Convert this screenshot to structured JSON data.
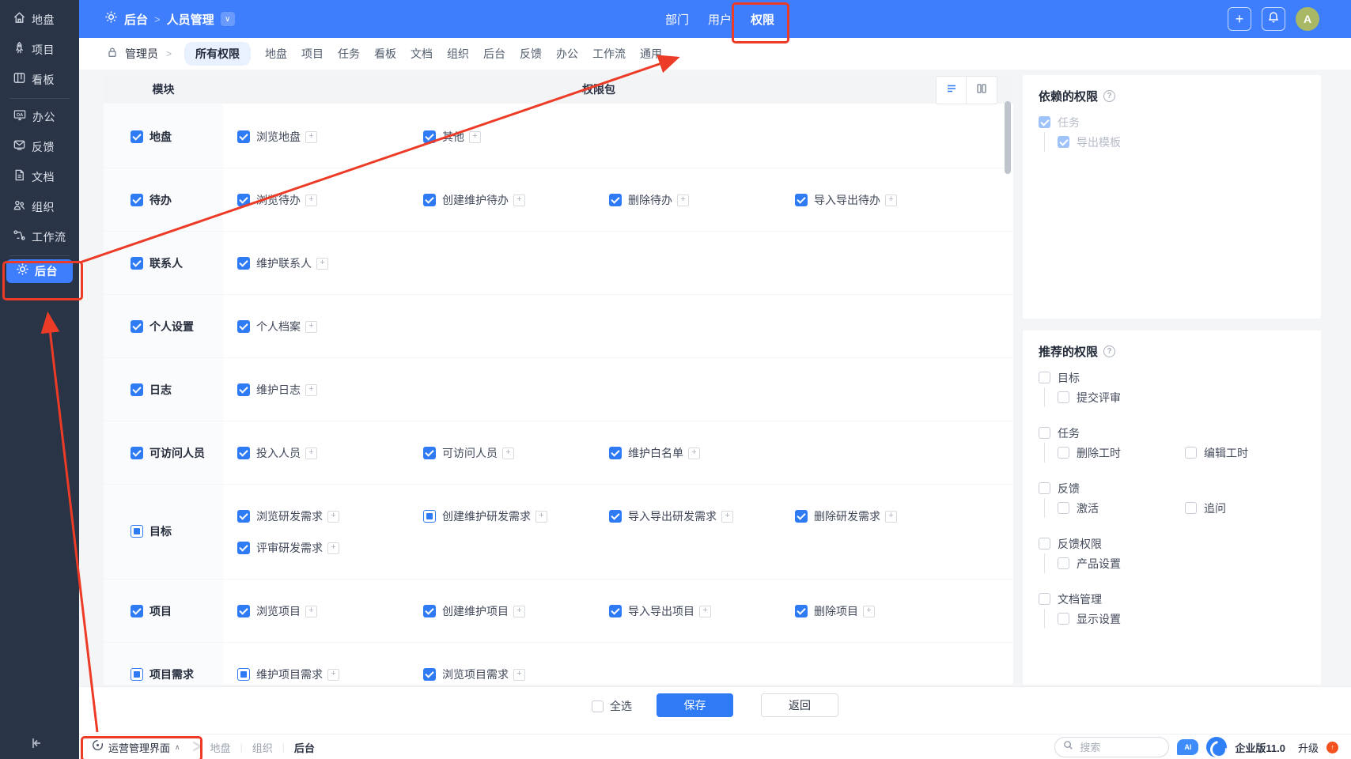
{
  "colors": {
    "accent": "#3e7dfc",
    "checkbox_blue": "#2f7bf6",
    "annotation_red": "#ec3b26",
    "sidebar_bg": "#2a3447",
    "avatar_bg": "#a8b864",
    "upgrade_badge": "#f4511e"
  },
  "glyphs": {
    "plus": "+",
    "chevron_down": "∨",
    "chevron_up": "∧",
    "gt": ">",
    "pipe": "|",
    "arrow_up": "↑"
  },
  "sidebar": {
    "items": [
      {
        "label": "地盘",
        "icon": "home-icon"
      },
      {
        "label": "项目",
        "icon": "rocket-icon"
      },
      {
        "label": "看板",
        "icon": "kanban-icon",
        "divider_after": true
      },
      {
        "label": "办公",
        "icon": "monitor-icon"
      },
      {
        "label": "反馈",
        "icon": "feedback-icon"
      },
      {
        "label": "文档",
        "icon": "document-icon"
      },
      {
        "label": "组织",
        "icon": "org-icon"
      },
      {
        "label": "工作流",
        "icon": "workflow-icon",
        "divider_after": true
      },
      {
        "label": "后台",
        "icon": "gear-icon",
        "active": true
      }
    ]
  },
  "header": {
    "breadcrumb": {
      "root": "后台",
      "current": "人员管理"
    },
    "tabs": [
      {
        "label": "部门"
      },
      {
        "label": "用户"
      },
      {
        "label": "权限",
        "highlighted": true
      }
    ],
    "avatar": "A"
  },
  "toolbar": {
    "role_label": "管理员",
    "tabs": [
      {
        "label": "所有权限",
        "active": true
      },
      {
        "label": "地盘"
      },
      {
        "label": "项目"
      },
      {
        "label": "任务"
      },
      {
        "label": "看板"
      },
      {
        "label": "文档"
      },
      {
        "label": "组织"
      },
      {
        "label": "后台"
      },
      {
        "label": "反馈"
      },
      {
        "label": "办公"
      },
      {
        "label": "工作流"
      },
      {
        "label": "通用"
      }
    ]
  },
  "table": {
    "module_header": "模块",
    "package_header": "权限包",
    "rows": [
      {
        "module": "地盘",
        "state": "checked",
        "perms": [
          {
            "label": "浏览地盘",
            "state": "checked",
            "col": 0,
            "line": 0
          },
          {
            "label": "其他",
            "state": "checked",
            "col": 1,
            "line": 0
          }
        ]
      },
      {
        "module": "待办",
        "state": "checked",
        "perms": [
          {
            "label": "浏览待办",
            "state": "checked",
            "col": 0,
            "line": 0
          },
          {
            "label": "创建维护待办",
            "state": "checked",
            "col": 1,
            "line": 0
          },
          {
            "label": "删除待办",
            "state": "checked",
            "col": 2,
            "line": 0
          },
          {
            "label": "导入导出待办",
            "state": "checked",
            "col": 3,
            "line": 0
          }
        ]
      },
      {
        "module": "联系人",
        "state": "checked",
        "perms": [
          {
            "label": "维护联系人",
            "state": "checked",
            "col": 0,
            "line": 0
          }
        ]
      },
      {
        "module": "个人设置",
        "state": "checked",
        "perms": [
          {
            "label": "个人档案",
            "state": "checked",
            "col": 0,
            "line": 0
          }
        ]
      },
      {
        "module": "日志",
        "state": "checked",
        "perms": [
          {
            "label": "维护日志",
            "state": "checked",
            "col": 0,
            "line": 0
          }
        ]
      },
      {
        "module": "可访问人员",
        "state": "checked",
        "perms": [
          {
            "label": "投入人员",
            "state": "checked",
            "col": 0,
            "line": 0
          },
          {
            "label": "可访问人员",
            "state": "checked",
            "col": 1,
            "line": 0
          },
          {
            "label": "维护白名单",
            "state": "checked",
            "col": 2,
            "line": 0
          }
        ]
      },
      {
        "module": "目标",
        "state": "indet",
        "tall": true,
        "perms": [
          {
            "label": "浏览研发需求",
            "state": "checked",
            "col": 0,
            "line": 0
          },
          {
            "label": "创建维护研发需求",
            "state": "indet",
            "col": 1,
            "line": 0
          },
          {
            "label": "导入导出研发需求",
            "state": "checked",
            "col": 2,
            "line": 0
          },
          {
            "label": "删除研发需求",
            "state": "checked",
            "col": 3,
            "line": 0
          },
          {
            "label": "评审研发需求",
            "state": "checked",
            "col": 0,
            "line": 1
          }
        ]
      },
      {
        "module": "项目",
        "state": "checked",
        "perms": [
          {
            "label": "浏览项目",
            "state": "checked",
            "col": 0,
            "line": 0
          },
          {
            "label": "创建维护项目",
            "state": "checked",
            "col": 1,
            "line": 0
          },
          {
            "label": "导入导出项目",
            "state": "checked",
            "col": 2,
            "line": 0
          },
          {
            "label": "删除项目",
            "state": "checked",
            "col": 3,
            "line": 0
          }
        ]
      },
      {
        "module": "项目需求",
        "state": "indet",
        "perms": [
          {
            "label": "维护项目需求",
            "state": "indet",
            "col": 0,
            "line": 0
          },
          {
            "label": "浏览项目需求",
            "state": "checked",
            "col": 1,
            "line": 0
          }
        ]
      }
    ]
  },
  "deps_panel": {
    "title": "依赖的权限",
    "groups": [
      {
        "label": "任务",
        "state": "disabled-checked",
        "children": [
          {
            "label": "导出模板",
            "state": "disabled-checked"
          }
        ]
      }
    ]
  },
  "rec_panel": {
    "title": "推荐的权限",
    "groups": [
      {
        "label": "目标",
        "state": "unchecked",
        "children": [
          {
            "label": "提交评审",
            "state": "unchecked"
          }
        ]
      },
      {
        "label": "任务",
        "state": "unchecked",
        "children": [
          {
            "label": "删除工时",
            "state": "unchecked"
          },
          {
            "label": "编辑工时",
            "state": "unchecked"
          }
        ]
      },
      {
        "label": "反馈",
        "state": "unchecked",
        "children": [
          {
            "label": "激活",
            "state": "unchecked"
          },
          {
            "label": "追问",
            "state": "unchecked"
          }
        ]
      },
      {
        "label": "反馈权限",
        "state": "unchecked",
        "children": [
          {
            "label": "产品设置",
            "state": "unchecked"
          }
        ]
      },
      {
        "label": "文档管理",
        "state": "unchecked",
        "children": [
          {
            "label": "显示设置",
            "state": "unchecked"
          }
        ]
      }
    ]
  },
  "footer": {
    "select_all": "全选",
    "save": "保存",
    "back": "返回"
  },
  "statusbar": {
    "workspace": "运营管理界面",
    "crumbs": [
      {
        "label": "地盘"
      },
      {
        "label": "组织"
      },
      {
        "label": "后台",
        "current": true
      }
    ],
    "search_placeholder": "搜索",
    "ai_label": "AI",
    "edition": "企业版11.0",
    "upgrade": "升级"
  },
  "annotations": {
    "color": "#ec3b26",
    "targets": [
      "permissions-top-tab",
      "backstage-sidebar-item",
      "workspace-switcher"
    ]
  }
}
